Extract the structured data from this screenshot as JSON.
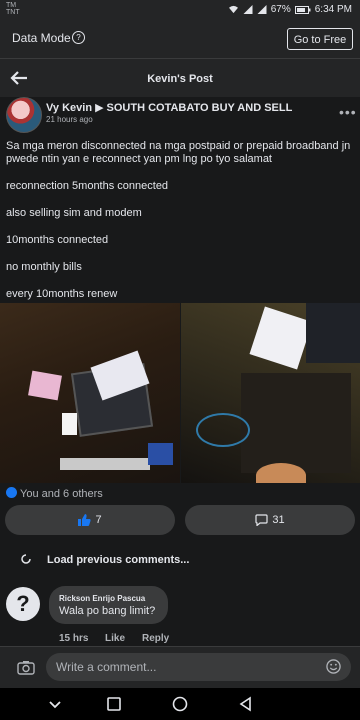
{
  "status_bar": {
    "carrier_line1": "TM",
    "carrier_line2": "TNT",
    "battery": "67%",
    "time": "6:34 PM"
  },
  "data_mode": {
    "label": "Data Mode",
    "go_free_label": "Go to Free"
  },
  "header": {
    "title": "Kevin's Post"
  },
  "post": {
    "author": "Vy Kevin",
    "group": "SOUTH COTABATO BUY AND SELL",
    "time": "21 hours ago",
    "paragraphs": [
      "Sa mga meron disconnected na mga postpaid or prepaid broadband jn pwede ntin yan e reconnect yan pm lng po tyo salamat",
      "reconnection 5months connected",
      "also selling sim and modem",
      "10months connected",
      "no monthly bills",
      "every 10months renew"
    ]
  },
  "reactions": {
    "summary": "You and 6 others",
    "like_count": "7",
    "comment_count": "31"
  },
  "comments": {
    "load_previous": "Load previous comments...",
    "items": [
      {
        "author": "Rickson Enrijo Pascua",
        "text": "Wala po bang limit?",
        "time": "15 hrs",
        "like_label": "Like",
        "reply_label": "Reply"
      }
    ]
  },
  "composer": {
    "placeholder": "Write a comment..."
  },
  "icons": {
    "back": "back-arrow-icon",
    "more": "more-icon",
    "camera": "camera-icon",
    "emoji": "emoji-icon"
  },
  "colors": {
    "background": "#18191a",
    "surface": "#242526",
    "pill": "#3a3b3c",
    "accent": "#1877f2",
    "text": "#e4e6eb",
    "muted": "#b0b3b8"
  }
}
